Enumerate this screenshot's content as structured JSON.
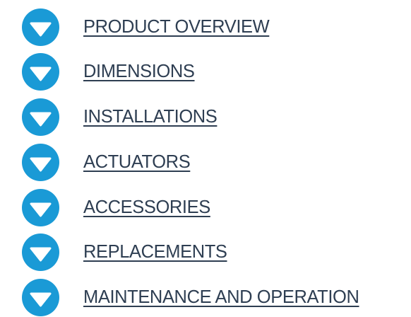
{
  "colors": {
    "icon_background": "#1a9ad6",
    "icon_glyph": "#ffffff",
    "link_text": "#2e3e52",
    "page_background": "#ffffff"
  },
  "icon_name": "chevron-down-icon",
  "sections": [
    {
      "id": "product-overview",
      "label": "PRODUCT OVERVIEW"
    },
    {
      "id": "dimensions",
      "label": "DIMENSIONS"
    },
    {
      "id": "installations",
      "label": "INSTALLATIONS"
    },
    {
      "id": "actuators",
      "label": "ACTUATORS"
    },
    {
      "id": "accessories",
      "label": "ACCESSORIES"
    },
    {
      "id": "replacements",
      "label": "REPLACEMENTS"
    },
    {
      "id": "maintenance-and-operation",
      "label": "MAINTENANCE AND OPERATION"
    }
  ]
}
